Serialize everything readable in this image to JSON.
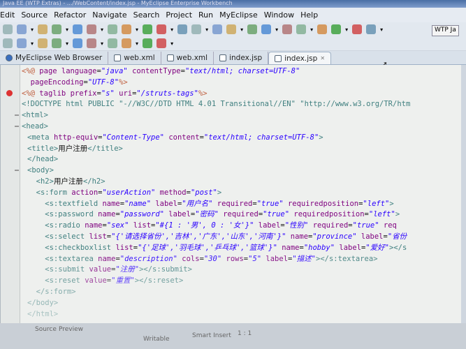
{
  "window": {
    "title": "Java EE (WTP Extras) - .../WebContent/index.jsp - MyEclipse Enterprise Workbench"
  },
  "menu": [
    "Edit",
    "Source",
    "Refactor",
    "Navigate",
    "Search",
    "Project",
    "Run",
    "MyEclipse",
    "Window",
    "Help"
  ],
  "perspective": "WTP Ja",
  "tabs": [
    {
      "label": "MyEclipse Web Browser"
    },
    {
      "label": "web.xml"
    },
    {
      "label": "web.xml"
    },
    {
      "label": "index.jsp"
    },
    {
      "label": "index.jsp",
      "active": true,
      "close": "✕"
    }
  ],
  "code": [
    [
      [
        "jsp",
        "<%@ "
      ],
      [
        "attr",
        "page "
      ],
      [
        "attr",
        "language"
      ],
      [
        "txt",
        "="
      ],
      [
        "val",
        "\"java\""
      ],
      [
        "attr",
        " contentType"
      ],
      [
        "txt",
        "="
      ],
      [
        "val",
        "\"text/html; charset=UTF-8\""
      ]
    ],
    [
      [
        "txt",
        "    "
      ],
      [
        "attr",
        "pageEncoding"
      ],
      [
        "txt",
        "="
      ],
      [
        "val",
        "\"UTF-8\""
      ],
      [
        "jsp",
        "%>"
      ]
    ],
    [
      [
        "jsp",
        "<%@ "
      ],
      [
        "attr",
        "taglib "
      ],
      [
        "attr",
        "prefix"
      ],
      [
        "txt",
        "="
      ],
      [
        "val",
        "\"s\""
      ],
      [
        "attr",
        " uri"
      ],
      [
        "txt",
        "="
      ],
      [
        "val",
        "\"/struts-tags\""
      ],
      [
        "jsp",
        "%>"
      ]
    ],
    [
      [
        "tag",
        "<!DOCTYPE html PUBLIC \"-//W3C//DTD HTML 4.01 Transitional//EN\" \"http://www.w3.org/TR/htm"
      ]
    ],
    [
      [
        "tag",
        "<html>"
      ]
    ],
    [
      [
        "tag",
        "<head>"
      ]
    ],
    [
      [
        "tag",
        "<meta "
      ],
      [
        "attr",
        "http-equiv"
      ],
      [
        "txt",
        "="
      ],
      [
        "val",
        "\"Content-Type\""
      ],
      [
        "attr",
        " content"
      ],
      [
        "txt",
        "="
      ],
      [
        "val",
        "\"text/html; charset=UTF-8\""
      ],
      [
        "tag",
        ">"
      ]
    ],
    [
      [
        "tag",
        "<title>"
      ],
      [
        "txt",
        "用户注册"
      ],
      [
        "tag",
        "</title>"
      ]
    ],
    [
      [
        "tag",
        "</head>"
      ]
    ],
    [
      [
        "tag",
        "<body>"
      ]
    ],
    [
      [
        "txt",
        "    "
      ],
      [
        "tag",
        "<h2>"
      ],
      [
        "txt",
        "用户注册"
      ],
      [
        "tag",
        "</h2>"
      ]
    ],
    [
      [
        "txt",
        "    "
      ],
      [
        "tag",
        "<s:form "
      ],
      [
        "attr",
        "action"
      ],
      [
        "txt",
        "="
      ],
      [
        "val",
        "\"userAction\""
      ],
      [
        "attr",
        " method"
      ],
      [
        "txt",
        "="
      ],
      [
        "val",
        "\"post\""
      ],
      [
        "tag",
        ">"
      ]
    ],
    [
      [
        "txt",
        "        "
      ],
      [
        "tag",
        "<s:textfield "
      ],
      [
        "attr",
        "name"
      ],
      [
        "txt",
        "="
      ],
      [
        "val",
        "\"name\""
      ],
      [
        "attr",
        " label"
      ],
      [
        "txt",
        "="
      ],
      [
        "val",
        "\"用户名\""
      ],
      [
        "attr",
        " required"
      ],
      [
        "txt",
        "="
      ],
      [
        "val",
        "\"true\""
      ],
      [
        "attr",
        " requiredposition"
      ],
      [
        "txt",
        "="
      ],
      [
        "val",
        "\"left\""
      ],
      [
        "tag",
        ">"
      ]
    ],
    [
      [
        "txt",
        "        "
      ],
      [
        "tag",
        "<s:password "
      ],
      [
        "attr",
        "name"
      ],
      [
        "txt",
        "="
      ],
      [
        "val",
        "\"password\""
      ],
      [
        "attr",
        " label"
      ],
      [
        "txt",
        "="
      ],
      [
        "val",
        "\"密码\""
      ],
      [
        "attr",
        " required"
      ],
      [
        "txt",
        "="
      ],
      [
        "val",
        "\"true\""
      ],
      [
        "attr",
        " requiredposition"
      ],
      [
        "txt",
        "="
      ],
      [
        "val",
        "\"left\""
      ],
      [
        "tag",
        ">"
      ]
    ],
    [
      [
        "txt",
        "        "
      ],
      [
        "tag",
        "<s:radio "
      ],
      [
        "attr",
        "name"
      ],
      [
        "txt",
        "="
      ],
      [
        "val",
        "\"sex\""
      ],
      [
        "attr",
        " list"
      ],
      [
        "txt",
        "="
      ],
      [
        "val",
        "\"#{1 : '男', 0 : '女'}\""
      ],
      [
        "attr",
        " label"
      ],
      [
        "txt",
        "="
      ],
      [
        "val",
        "\"性别\""
      ],
      [
        "attr",
        " required"
      ],
      [
        "txt",
        "="
      ],
      [
        "val",
        "\"true\""
      ],
      [
        "attr",
        " req"
      ]
    ],
    [
      [
        "txt",
        "        "
      ],
      [
        "tag",
        "<s:select "
      ],
      [
        "attr",
        "list"
      ],
      [
        "txt",
        "="
      ],
      [
        "val",
        "\"{'请选择省份','吉林','广东','山东','河南'}\""
      ],
      [
        "attr",
        " name"
      ],
      [
        "txt",
        "="
      ],
      [
        "val",
        "\"province\""
      ],
      [
        "attr",
        " label"
      ],
      [
        "txt",
        "="
      ],
      [
        "val",
        "\"省份"
      ]
    ],
    [
      [
        "txt",
        "        "
      ],
      [
        "tag",
        "<s:checkboxlist "
      ],
      [
        "attr",
        "list"
      ],
      [
        "txt",
        "="
      ],
      [
        "val",
        "\"{'足球','羽毛球','乒乓球','篮球'}\""
      ],
      [
        "attr",
        " name"
      ],
      [
        "txt",
        "="
      ],
      [
        "val",
        "\"hobby\""
      ],
      [
        "attr",
        " label"
      ],
      [
        "txt",
        "="
      ],
      [
        "val",
        "\"爱好\""
      ],
      [
        "tag",
        "></s"
      ]
    ],
    [
      [
        "txt",
        "        "
      ],
      [
        "tag",
        "<s:textarea "
      ],
      [
        "attr",
        "name"
      ],
      [
        "txt",
        "="
      ],
      [
        "val",
        "\"description\""
      ],
      [
        "attr",
        " cols"
      ],
      [
        "txt",
        "="
      ],
      [
        "val",
        "\"30\""
      ],
      [
        "attr",
        " rows"
      ],
      [
        "txt",
        "="
      ],
      [
        "val",
        "\"5\""
      ],
      [
        "attr",
        " label"
      ],
      [
        "txt",
        "="
      ],
      [
        "val",
        "\"描述\""
      ],
      [
        "tag",
        "></s:textarea>"
      ]
    ],
    [
      [
        "txt",
        "        "
      ],
      [
        "tag",
        "<s:submit "
      ],
      [
        "attr",
        "value"
      ],
      [
        "txt",
        "="
      ],
      [
        "val",
        "\"注册\""
      ],
      [
        "tag",
        "></s:submit>"
      ]
    ],
    [
      [
        "txt",
        "        "
      ],
      [
        "tag",
        "<s:reset "
      ],
      [
        "attr",
        "value"
      ],
      [
        "txt",
        "="
      ],
      [
        "val",
        "\"重置\""
      ],
      [
        "tag",
        "></s:reset>"
      ]
    ],
    [
      [
        "txt",
        "    "
      ],
      [
        "tag",
        "</s:form>"
      ]
    ],
    [
      [
        "tag",
        "</body>"
      ]
    ],
    [
      [
        "tag",
        "</html>"
      ]
    ]
  ],
  "editor_tabs": {
    "source": "Source",
    "preview": "Preview"
  },
  "status": {
    "writable": "Writable",
    "insert": "Smart Insert",
    "position": "1 : 1"
  }
}
